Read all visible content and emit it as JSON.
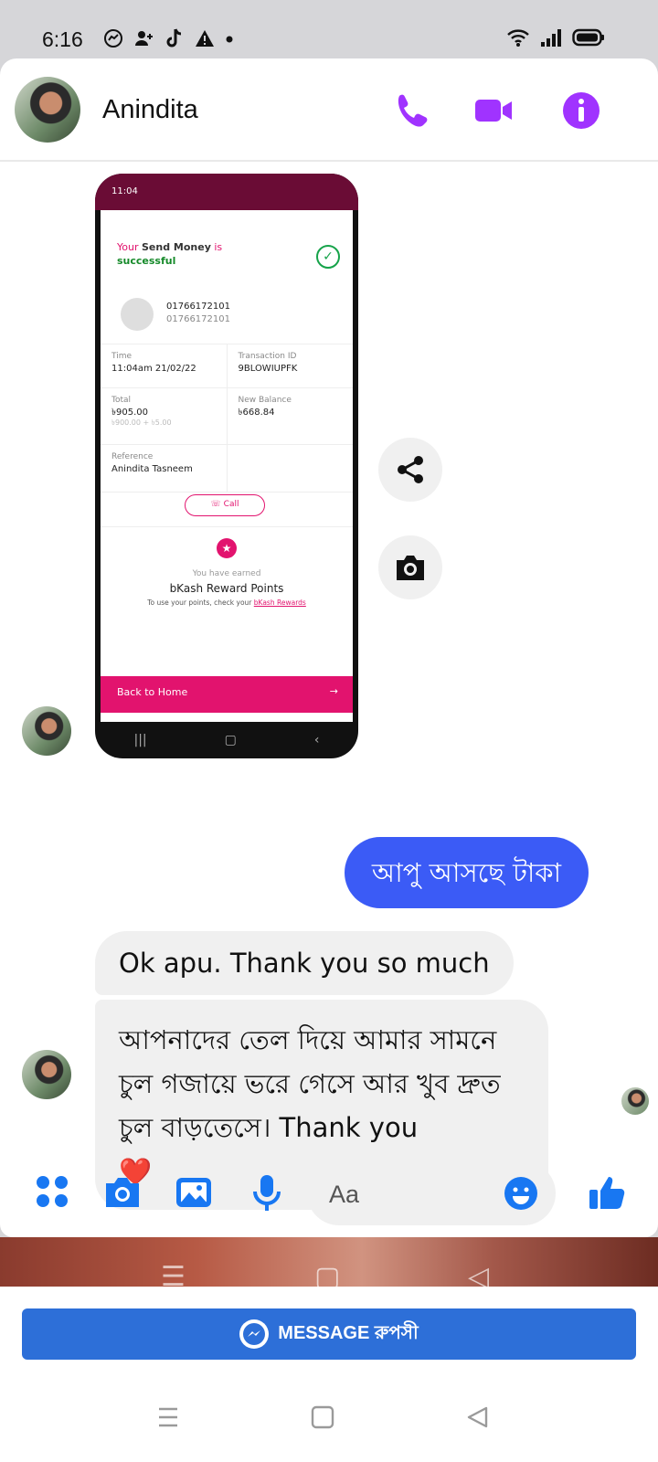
{
  "status_bar": {
    "time": "6:16"
  },
  "header": {
    "contact_name": "Anindita"
  },
  "shared_screenshot": {
    "status_time": "11:04",
    "success_prefix": "Your",
    "success_bold": "Send Money",
    "success_suffix": "is",
    "success_word": "successful",
    "recipient_number": "01766172101",
    "recipient_number_sub": "01766172101",
    "time_label": "Time",
    "time_value": "11:04am 21/02/22",
    "txn_label": "Transaction ID",
    "txn_value": "9BLOWIUPFK",
    "total_label": "Total",
    "total_value": "৳905.00",
    "total_breakdown": "৳900.00 + ৳5.00",
    "balance_label": "New Balance",
    "balance_value": "৳668.84",
    "reference_label": "Reference",
    "reference_value": "Anindita Tasneem",
    "call_label": "Call",
    "earned_label": "You have earned",
    "reward_title": "bKash Reward Points",
    "reward_hint": "To use your points, check your",
    "reward_link": "bKash Rewards",
    "back_label": "Back to Home"
  },
  "messages": {
    "outgoing_1": "আপু আসছে টাকা",
    "incoming_1": "Ok apu. Thank you so much",
    "incoming_2": "আপনাদের তেল দিয়ে আমার সামনে চুল গজায়ে ভরে গেসে আর খুব দ্রুত চুল বাড়তেসে। Thank you",
    "incoming_2_emoji": "❤️"
  },
  "composer": {
    "placeholder": "Aa"
  },
  "bottom_cta": {
    "label": "MESSAGE রুপসী"
  },
  "colors": {
    "messenger_purple": "#a033ff",
    "outgoing_blue": "#3b5bf6",
    "bkash_pink": "#e2136e",
    "cta_blue": "#2d6fd8"
  }
}
